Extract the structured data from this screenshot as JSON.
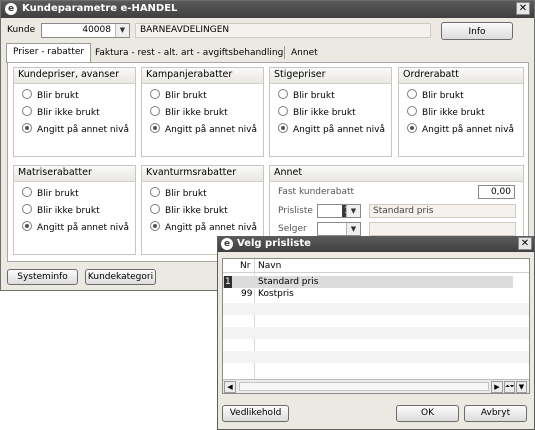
{
  "main_window": {
    "title": "Kundeparametre e-HANDEL",
    "close_glyph": "✕",
    "logo_letter": "e"
  },
  "customer": {
    "label": "Kunde",
    "number": "40008",
    "name": "BARNEAVDELINGEN",
    "info_button": "Info"
  },
  "tabs": [
    {
      "label": "Priser - rabatter",
      "active": true
    },
    {
      "label": "Faktura - rest - alt. art - avgiftsbehandling",
      "active": false
    },
    {
      "label": "Annet",
      "active": false
    }
  ],
  "radio_groups": [
    {
      "title": "Kundepriser, avanser",
      "options": [
        "Blir brukt",
        "Blir ikke brukt",
        "Angitt på annet nivå"
      ],
      "selected": 2
    },
    {
      "title": "Kampanjerabatter",
      "options": [
        "Blir brukt",
        "Blir ikke brukt",
        "Angitt på annet nivå"
      ],
      "selected": 2
    },
    {
      "title": "Stigepriser",
      "options": [
        "Blir brukt",
        "Blir ikke brukt",
        "Angitt på annet nivå"
      ],
      "selected": 2
    },
    {
      "title": "Ordrerabatt",
      "options": [
        "Blir brukt",
        "Blir ikke brukt",
        "Angitt på annet nivå"
      ],
      "selected": 2
    },
    {
      "title": "Matriserabatter",
      "options": [
        "Blir brukt",
        "Blir ikke brukt",
        "Angitt på annet nivå"
      ],
      "selected": 2
    },
    {
      "title": "Kvanturmsrabatter",
      "options": [
        "Blir brukt",
        "Blir ikke brukt",
        "Angitt på annet nivå"
      ],
      "selected": 2
    }
  ],
  "annet": {
    "title": "Annet",
    "discount_label": "Fast kunderabatt",
    "discount_value": "0,00",
    "pricelist_label": "Prisliste",
    "pricelist_value": "1",
    "pricelist_name": "Standard pris",
    "seller_label": "Selger",
    "seller_value": "",
    "seller_name": ""
  },
  "bottom_buttons": {
    "systeminfo": "Systeminfo",
    "kundekategori": "Kundekategori"
  },
  "popup": {
    "title": "Velg prisliste",
    "close_glyph": "✕",
    "logo_letter": "e",
    "columns": [
      "Nr",
      "Navn"
    ],
    "rows": [
      {
        "nr": "1",
        "navn": "Standard pris",
        "selected": true
      },
      {
        "nr": "99",
        "navn": "Kostpris",
        "selected": false
      }
    ],
    "buttons": {
      "maintain": "Vedlikehold",
      "ok": "OK",
      "cancel": "Avbryt"
    },
    "scroll_left_glyph": "◀",
    "scroll_right_glyph": "▶",
    "scroll_jump_glyph": "⏶⏷"
  },
  "icons": {
    "dropdown": "chevron-down-icon",
    "radio": "radio-icon"
  },
  "colors": {
    "titlebar": "#4a4a4a",
    "window_bg": "#ece9e2",
    "selected_row": "#d9d9d9"
  }
}
